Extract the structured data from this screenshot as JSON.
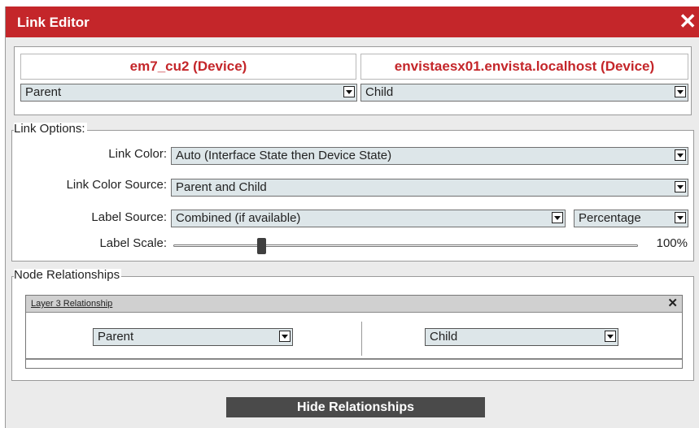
{
  "dialog": {
    "title": "Link Editor"
  },
  "devices": {
    "left": {
      "name": "em7_cu2 (Device)",
      "role": "Parent"
    },
    "right": {
      "name": "envistaesx01.envista.localhost (Device)",
      "role": "Child"
    }
  },
  "link_options": {
    "legend": "Link Options:",
    "link_color": {
      "label": "Link Color:",
      "value": "Auto (Interface State then Device State)"
    },
    "link_color_source": {
      "label": "Link Color Source:",
      "value": "Parent and Child"
    },
    "label_source": {
      "label": "Label Source:",
      "value": "Combined (if available)",
      "format": "Percentage"
    },
    "label_scale": {
      "label": "Label Scale:",
      "value_text": "100%",
      "level": 0.19
    }
  },
  "node_relationships": {
    "legend": "Node Relationships",
    "relationship": {
      "title": "Layer 3 Relationship",
      "close": "✕",
      "left": "Parent",
      "right": "Child"
    }
  },
  "footer": {
    "hide_relationships": "Hide Relationships"
  },
  "colors": {
    "titlebar": "#c4262a",
    "device_name": "#c4262a",
    "select_bg": "#dde6e9"
  }
}
